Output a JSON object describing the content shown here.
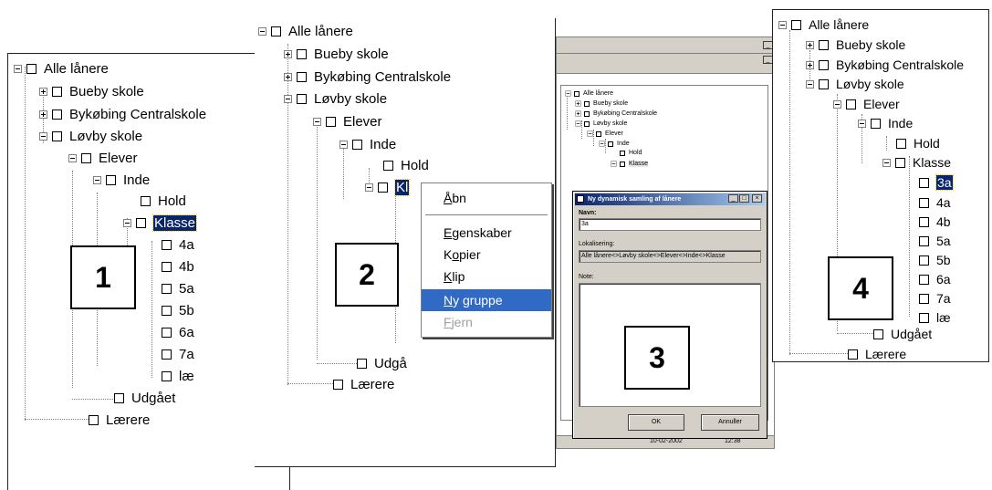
{
  "panel1": {
    "number": "1",
    "items": [
      "Alle lånere",
      "Bueby skole",
      "Bykøbing Centralskole",
      "Løvby skole",
      "Elever",
      "Inde",
      "Hold",
      "Klasse",
      "4a",
      "4b",
      "5a",
      "5b",
      "6a",
      "7a",
      "læ",
      "Udgået",
      "Lærere"
    ]
  },
  "panel2": {
    "number": "2",
    "items": [
      "Alle lånere",
      "Bueby skole",
      "Bykøbing Centralskole",
      "Løvby skole",
      "Elever",
      "Inde",
      "Hold",
      "Kl",
      "Udgå",
      "Lærere"
    ],
    "context_menu": {
      "open": "Åbn",
      "properties": "Egenskaber",
      "copy": "Kopier",
      "cut": "Klip",
      "new_group": "Ny gruppe",
      "remove": "Fjern"
    }
  },
  "panel3": {
    "number": "3",
    "tree": [
      "Alle lånere",
      "Bueby skole",
      "Bykøbing Centralskole",
      "Løvby skole",
      "Elever",
      "Inde",
      "Hold",
      "Klasse"
    ],
    "dialog": {
      "title": "Ny dynamisk samling af lånere",
      "name_label": "Navn:",
      "name_value": "3a",
      "location_label": "Lokalisering:",
      "location_value": "Alle lånere<>Løvby skole<>Elever<>Inde<>Klasse",
      "note_label": "Note:",
      "ok": "OK",
      "cancel": "Annuller"
    },
    "status_date": "10-02-2002",
    "status_time": "12:38"
  },
  "panel4": {
    "number": "4",
    "items": [
      "Alle lånere",
      "Bueby skole",
      "Bykøbing Centralskole",
      "Løvby skole",
      "Elever",
      "Inde",
      "Hold",
      "Klasse",
      "3a",
      "4a",
      "4b",
      "5a",
      "5b",
      "6a",
      "7a",
      "læ",
      "Udgået",
      "Lærere"
    ]
  }
}
